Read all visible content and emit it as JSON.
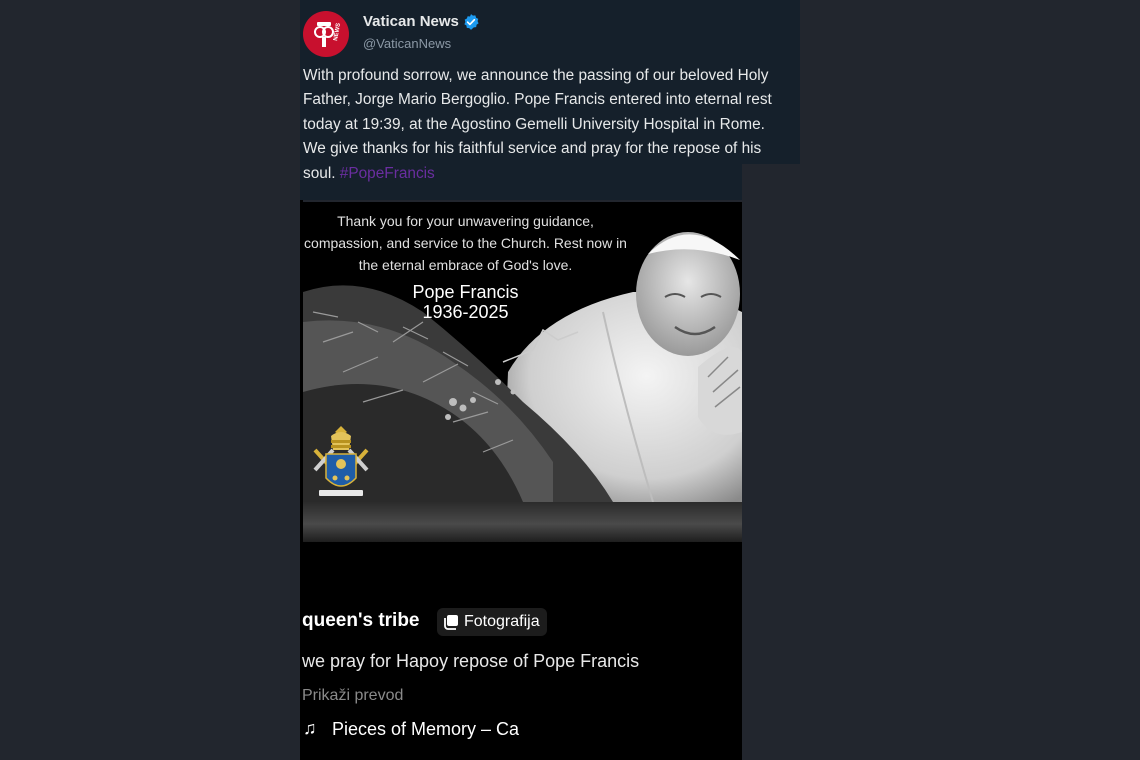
{
  "tweet": {
    "avatar_label": "NEWS",
    "author_name": "Vatican News",
    "verified": true,
    "handle": "@VaticanNews",
    "text": "With profound sorrow, we announce the passing of our beloved Holy Father, Jorge Mario Bergoglio. Pope Francis entered into eternal rest today at 19:39, at the Agostino Gemelli University Hospital in Rome. We give thanks for his faithful service and pray for the repose of his soul.",
    "hashtag": "#PopeFrancis"
  },
  "media": {
    "caption": "Thank you for your unwavering guidance, compassion, and service to the Church. Rest now in the eternal embrace of God's love.",
    "name": "Pope Francis",
    "years": "1936-2025"
  },
  "reel": {
    "username": "queen's tribe",
    "tag_label": "Fotografija",
    "tag_icon": "photo-icon",
    "text": "we pray for Hapoy repose of Pope Francis",
    "translate_label": "Prikaži prevod",
    "music_icon": "♫",
    "music_track": "Pieces of Memory – Ca"
  },
  "colors": {
    "background": "#22262e",
    "tweet_bg": "#15202b",
    "verified": "#1d9bf0",
    "avatar": "#c8102e",
    "hashtag": "#6a2ea0"
  }
}
